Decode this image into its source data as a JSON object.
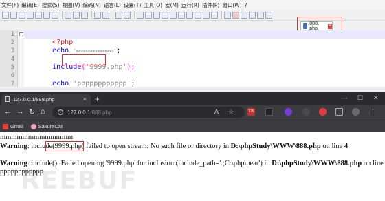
{
  "editor": {
    "menus": [
      "文件(F)",
      "编辑(E)",
      "搜索(S)",
      "视图(V)",
      "编码(N)",
      "语言(L)",
      "设置(T)",
      "工具(O)",
      "宏(M)",
      "运行(R)",
      "插件(P)",
      "窗口(W)",
      "?"
    ],
    "tab_label": "888. php",
    "tab_close": "×",
    "line_numbers": [
      "1",
      "2",
      "3",
      "4",
      "5",
      "6",
      "7"
    ],
    "code": {
      "l1": "<?php",
      "l2_kw": "echo",
      "l2_str": "'mmmmmmmmmmmmm'",
      "l2_end": ";",
      "l4_kw": "include",
      "l4_open": "(",
      "l4_str": "'9999.php'",
      "l4_close": ");",
      "l6_kw": "echo",
      "l6_str": "'pppppppppppp'",
      "l6_end": ";",
      "l7": "?>"
    },
    "colors": {
      "keyword": "#0000ff",
      "string": "#808080",
      "tag": "#e41b1b",
      "highlight": "#e0292a"
    }
  },
  "browser": {
    "tab_title": "127.0.0.1/888.php",
    "tab_close": "×",
    "new_tab": "+",
    "controls": {
      "minimize": "—",
      "maximize": "☐",
      "close": "✕"
    },
    "nav": {
      "back": "←",
      "forward": "→",
      "reload": "↻",
      "home": "⌂"
    },
    "url_host": "127.0.0.1",
    "url_path": "/888.php",
    "extension_badge": "125",
    "bookmarks": [
      {
        "label": "Gmail",
        "icon": "gmail-icon"
      },
      {
        "label": "SakuraCat",
        "icon": "sakuracat-icon"
      }
    ]
  },
  "page": {
    "line1": "mmmmmmmmmmmmm",
    "w1_label": "Warning",
    "w1_a": ": include",
    "w1_b": "(9999.php)",
    "w1_c": " failed to open stream: No such file or directory in ",
    "w1_path": "D:\\phpStudy\\WWW\\888.php",
    "w1_d": " on line ",
    "w1_line": "4",
    "w2_label": "Warning",
    "w2_a": ": include(): Failed opening '9999.php' for inclusion (include_path='.;C:\\php\\pear') in ",
    "w2_path": "D:\\phpStudy\\WWW\\888.php",
    "w2_d": " on line",
    "line_last": "pppppppppppp",
    "watermark": "REEBUF"
  }
}
